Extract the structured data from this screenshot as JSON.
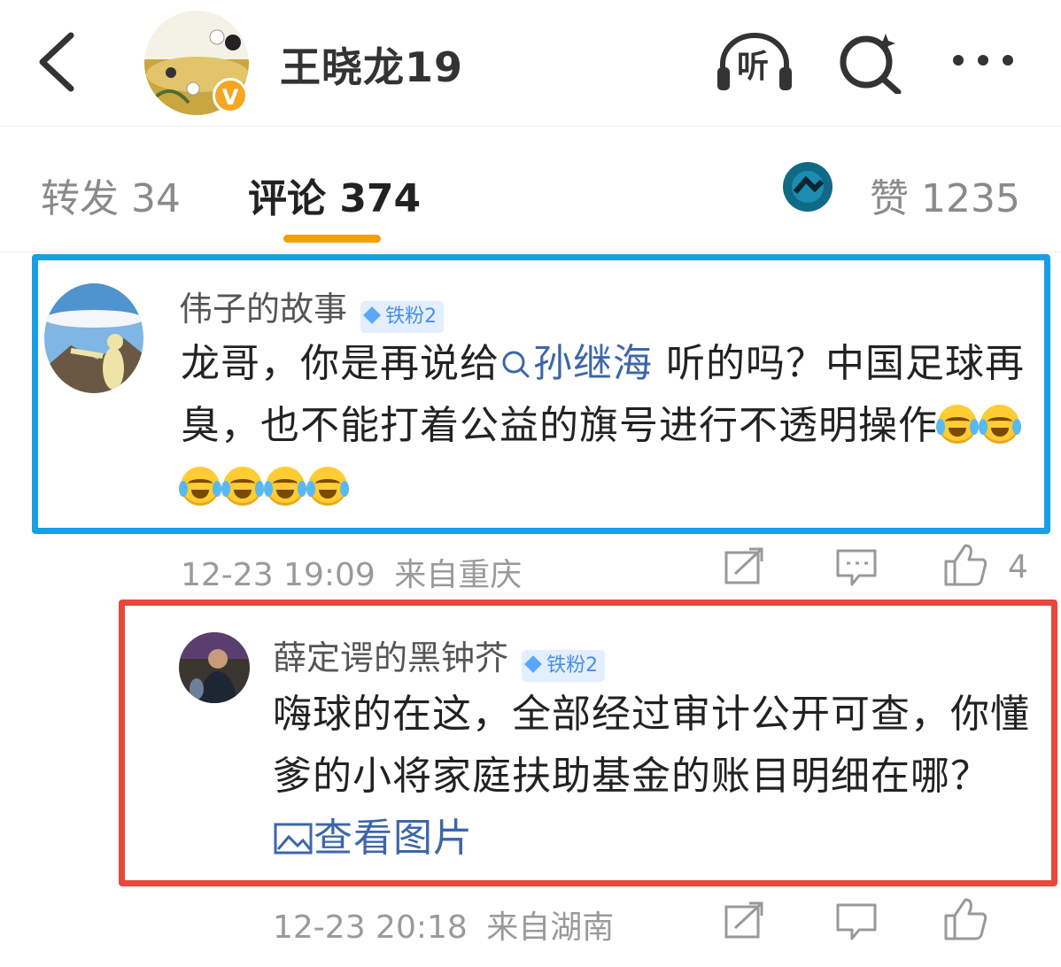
{
  "header": {
    "title": "王晓龙19",
    "listen_label": "听",
    "verified_label": "V"
  },
  "tabs": {
    "repost_label": "转发 34",
    "comment_label": "评论 374",
    "like_label": "赞 1235"
  },
  "comments": [
    {
      "author": "伟子的故事",
      "badge": "铁粉2",
      "text_before": "龙哥，你是再说给",
      "topic_link": "孙继海",
      "text_after": "听的吗？中国足球再臭，也不能打着公益的旗号进行不透明操作",
      "emoji_count": 6,
      "time": "12-23 19:09",
      "location": "来自重庆",
      "likes": "4"
    },
    {
      "author": "薛定谔的黑钟芥",
      "badge": "铁粉2",
      "text": "嗨球的在这，全部经过审计公开可查，你懂爹的小将家庭扶助基金的账目明细在哪？",
      "image_link": "查看图片",
      "time": "12-23 20:18",
      "location": "来自湖南"
    }
  ],
  "colors": {
    "accent": "#f5a000",
    "blue_highlight": "#1a9ee6",
    "red_highlight": "#e8473b",
    "link": "#3d66a8"
  }
}
